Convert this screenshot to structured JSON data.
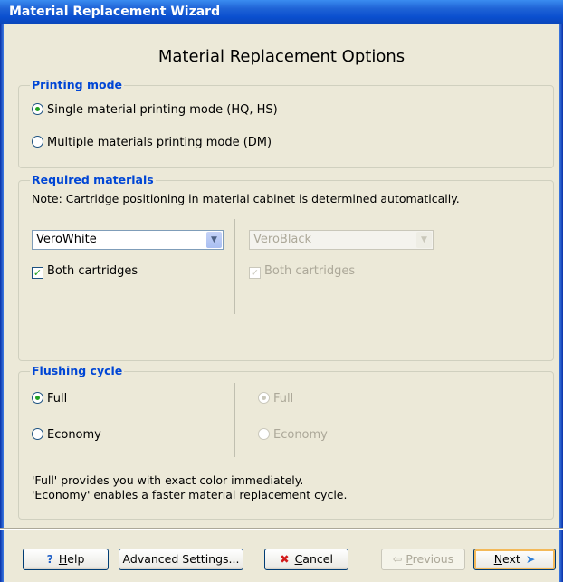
{
  "window": {
    "title": "Material Replacement Wizard"
  },
  "heading": "Material Replacement Options",
  "printing_mode": {
    "title": "Printing mode",
    "options": [
      {
        "label": "Single material printing mode (HQ, HS)",
        "selected": true
      },
      {
        "label": "Multiple materials printing mode (DM)",
        "selected": false
      }
    ]
  },
  "required_materials": {
    "title": "Required materials",
    "note": "Note: Cartridge positioning in material cabinet is determined automatically.",
    "left": {
      "material": "VeroWhite",
      "both_cartridges_label": "Both cartridges",
      "both_cartridges_checked": true,
      "enabled": true
    },
    "right": {
      "material": "VeroBlack",
      "both_cartridges_label": "Both cartridges",
      "both_cartridges_checked": true,
      "enabled": false
    }
  },
  "flushing_cycle": {
    "title": "Flushing cycle",
    "left": {
      "full_label": "Full",
      "economy_label": "Economy",
      "selected": "Full"
    },
    "right": {
      "full_label": "Full",
      "economy_label": "Economy",
      "selected": "Full",
      "enabled": false
    },
    "info_line1": "'Full' provides you with exact color immediately.",
    "info_line2": "'Economy' enables a faster material replacement cycle."
  },
  "buttons": {
    "help_prefix": "",
    "help_u": "H",
    "help_rest": "elp",
    "advanced": "Advanced Settings...",
    "cancel_u": "C",
    "cancel_rest": "ancel",
    "previous_u": "P",
    "previous_rest": "revious",
    "next_u": "N",
    "next_rest": "ext"
  },
  "colors": {
    "accent": "#0046d5",
    "title_bar": "#0a4fcf",
    "selected_green": "#21a121"
  }
}
